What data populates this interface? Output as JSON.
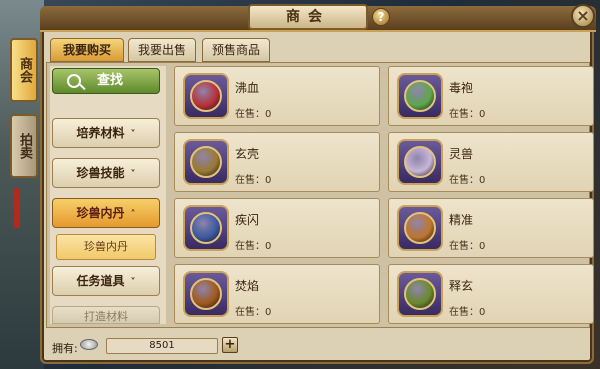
{
  "window": {
    "title": "商会",
    "help_label": "?",
    "close_label": "×"
  },
  "side_tabs": [
    {
      "label": "商会",
      "active": true
    },
    {
      "label": "拍卖",
      "active": false
    }
  ],
  "tabs": [
    {
      "label": "我要购买",
      "active": true
    },
    {
      "label": "我要出售",
      "active": false
    },
    {
      "label": "预售商品",
      "active": false
    }
  ],
  "search": {
    "label": "查找"
  },
  "categories": [
    {
      "label": "培养材料",
      "chevron": "˅"
    },
    {
      "label": "珍兽技能",
      "chevron": "˅"
    },
    {
      "label": "珍兽内丹",
      "chevron": "˄",
      "active": true
    },
    {
      "label": "任务道具",
      "chevron": "˅"
    },
    {
      "label": "打造材料"
    }
  ],
  "subcategory": {
    "label": "珍兽内丹"
  },
  "items": [
    {
      "name": "沸血",
      "sale_label": "在售：",
      "sale_count": "0",
      "orb_color": "#b8323a"
    },
    {
      "name": "毒袍",
      "sale_label": "在售：",
      "sale_count": "0",
      "orb_color": "#5ea84a"
    },
    {
      "name": "玄壳",
      "sale_label": "在售：",
      "sale_count": "0",
      "orb_color": "#9a7a32"
    },
    {
      "name": "灵兽",
      "sale_label": "在售：",
      "sale_count": "0",
      "orb_color": "#c8b7d6"
    },
    {
      "name": "疾闪",
      "sale_label": "在售：",
      "sale_count": "0",
      "orb_color": "#3c5aa0"
    },
    {
      "name": "精准",
      "sale_label": "在售：",
      "sale_count": "0",
      "orb_color": "#c0762c"
    },
    {
      "name": "焚焰",
      "sale_label": "在售：",
      "sale_count": "0",
      "orb_color": "#a05a1c"
    },
    {
      "name": "释玄",
      "sale_label": "在售：",
      "sale_count": "0",
      "orb_color": "#6a8a2a"
    }
  ],
  "currency": {
    "label": "拥有:",
    "amount": "8501",
    "add_label": "+",
    "coin_icon": "silver-ingot-icon"
  }
}
